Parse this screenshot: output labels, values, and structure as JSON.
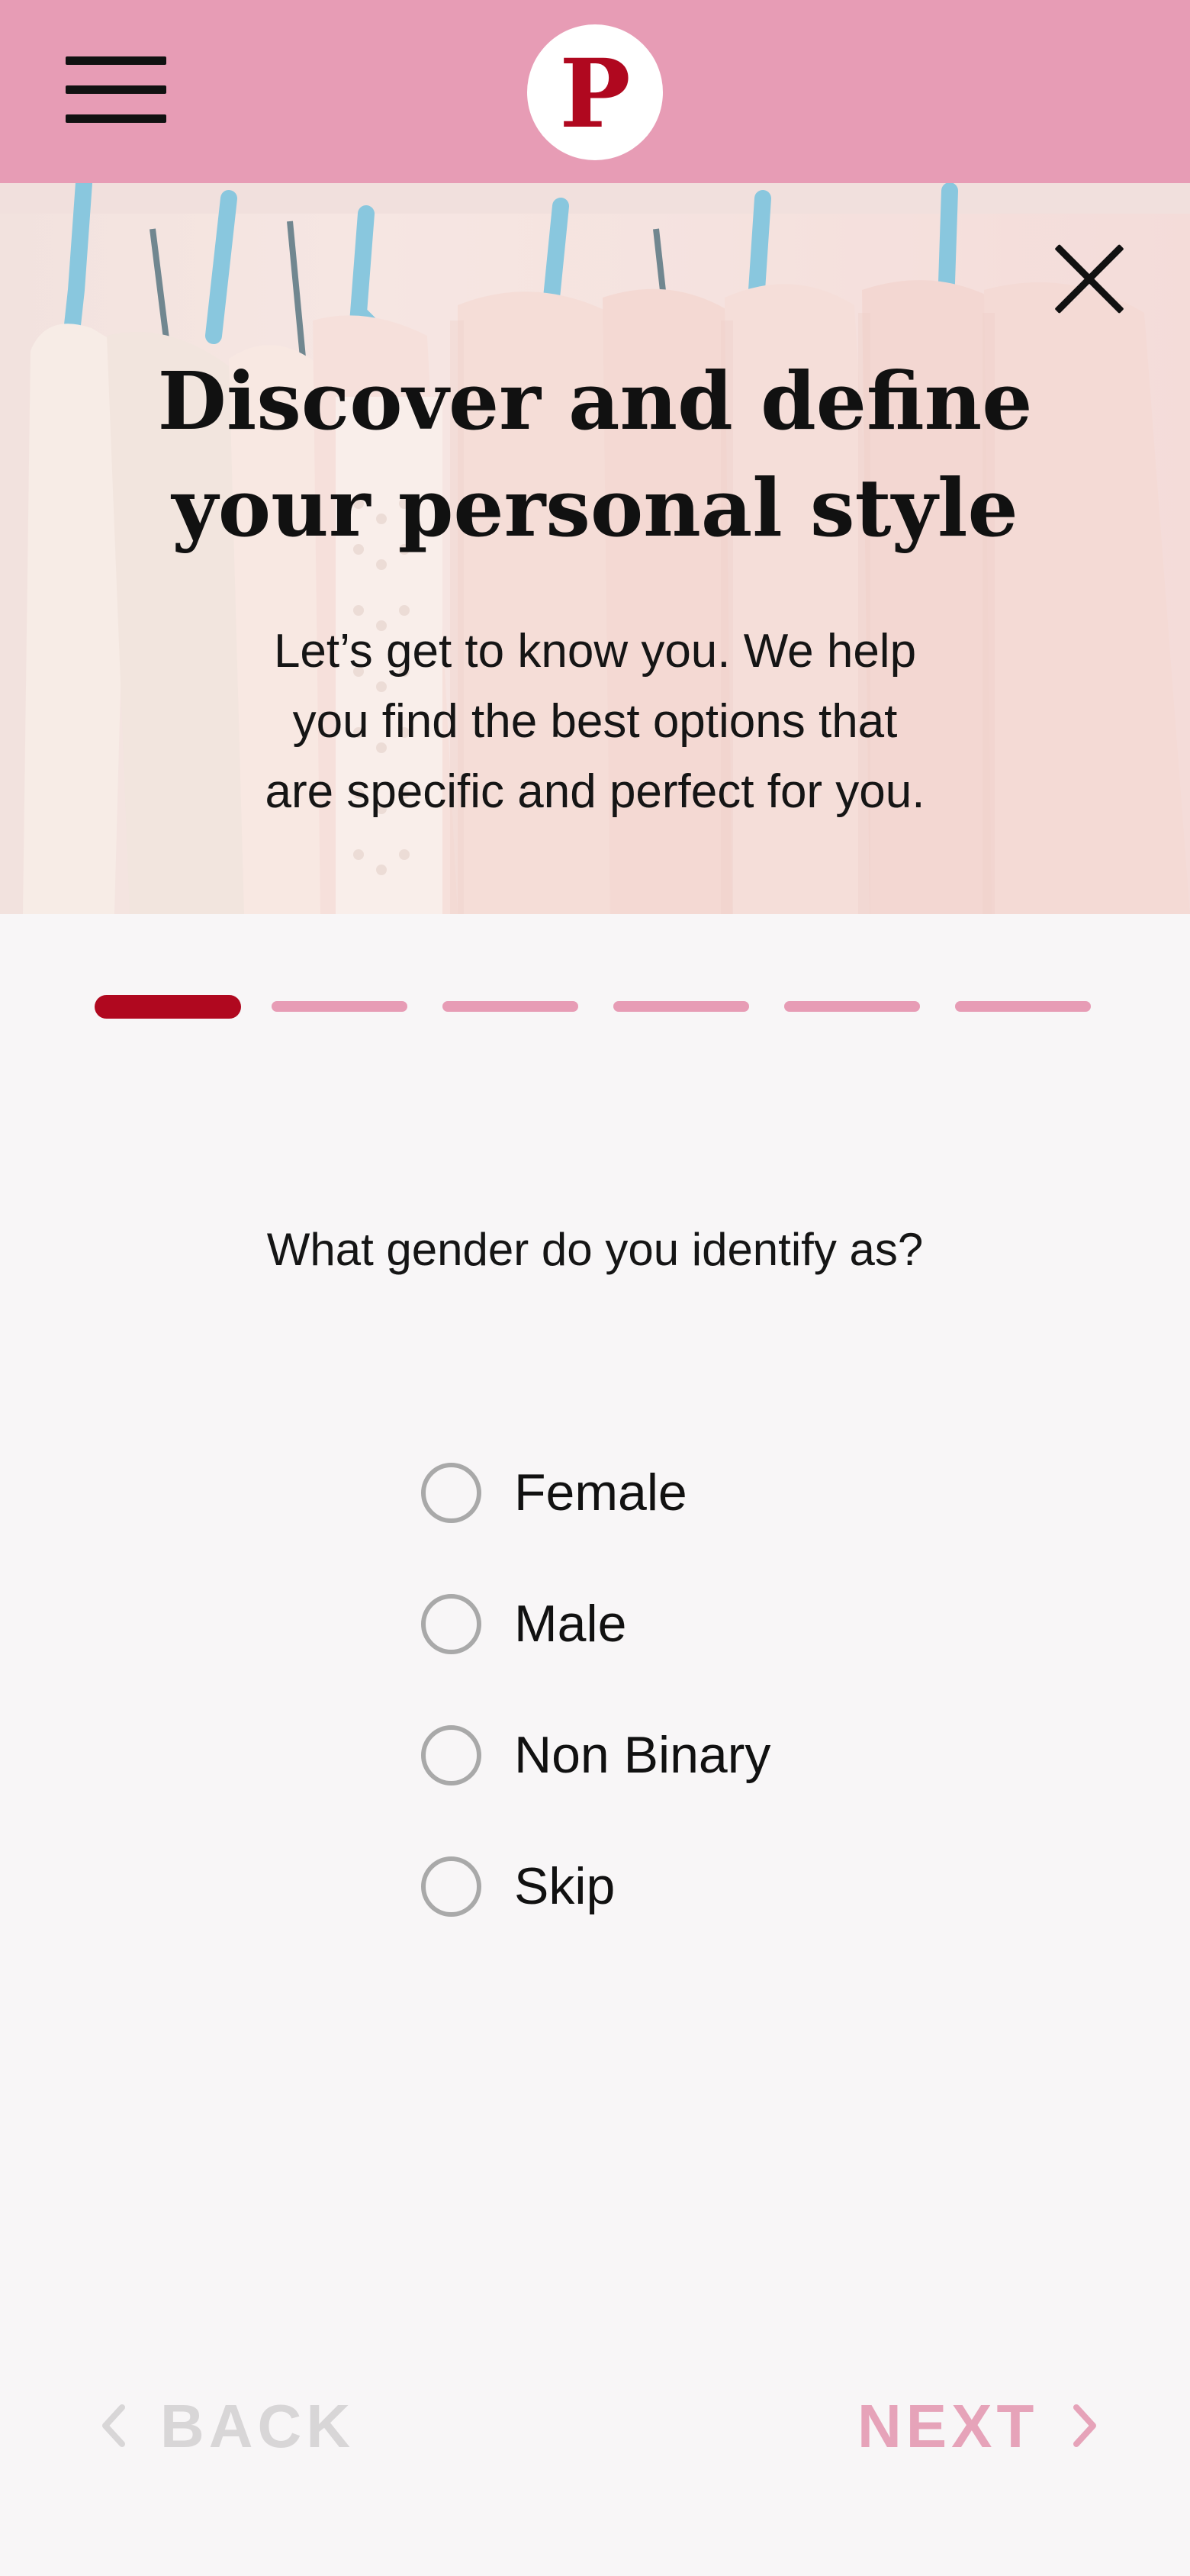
{
  "header": {
    "menu_icon": "hamburger-menu-icon",
    "logo_letter": "P",
    "colors": {
      "bar": "#e79cb5",
      "logo_bg": "#ffffff",
      "logo_letter": "#b0081f"
    }
  },
  "hero": {
    "title_lines": [
      "Discover and define",
      "your personal style"
    ],
    "subtitle_lines": [
      "Let’s get to know you. We help",
      "you find the best options that",
      "are specific and perfect for you."
    ],
    "close_icon": "close-icon",
    "background_image": "clothes-on-hangers-photo"
  },
  "progress": {
    "current_step": 1,
    "total_steps": 6,
    "active_color": "#b0081f",
    "inactive_color": "#e79cb5"
  },
  "question": {
    "text": "What gender do you identify as?",
    "options": [
      {
        "label": "Female",
        "selected": false
      },
      {
        "label": "Male",
        "selected": false
      },
      {
        "label": "Non Binary",
        "selected": false
      },
      {
        "label": "Skip",
        "selected": false
      }
    ]
  },
  "footer": {
    "back_label": "BACK",
    "next_label": "NEXT",
    "back_icon": "chevron-left-icon",
    "next_icon": "chevron-right-icon",
    "back_color": "#d8d6d7",
    "next_color": "#e6a3b9"
  }
}
